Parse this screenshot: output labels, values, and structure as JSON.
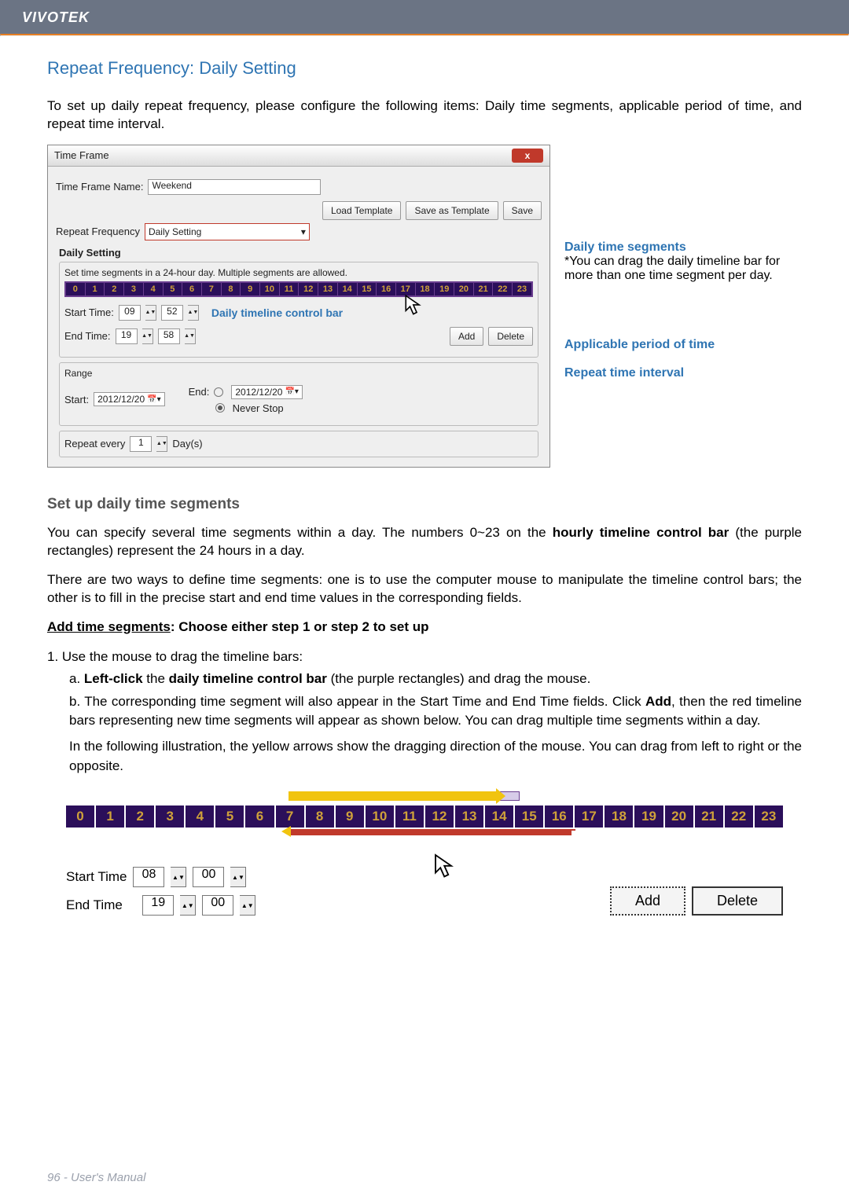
{
  "header": {
    "brand": "VIVOTEK"
  },
  "section_title": "Repeat Frequency: Daily Setting",
  "intro_para": "To set up daily repeat frequency, please configure the following items: Daily time segments, applicable period of time, and repeat time interval.",
  "dialog": {
    "title": "Time Frame",
    "close": "x",
    "name_label": "Time Frame Name:",
    "name_value": "Weekend",
    "repeat_label": "Repeat Frequency",
    "repeat_value": "Daily Setting",
    "buttons": {
      "load": "Load Template",
      "saveas": "Save as Template",
      "save": "Save"
    },
    "daily_heading": "Daily Setting",
    "daily_hint": "Set time segments in a 24-hour day. Multiple segments are allowed.",
    "hours": [
      "0",
      "1",
      "2",
      "3",
      "4",
      "5",
      "6",
      "7",
      "8",
      "9",
      "10",
      "11",
      "12",
      "13",
      "14",
      "15",
      "16",
      "17",
      "18",
      "19",
      "20",
      "21",
      "22",
      "23"
    ],
    "start_label": "Start Time:",
    "start_hh": "09",
    "start_mm": "52",
    "end_label": "End Time:",
    "end_hh": "19",
    "end_mm": "58",
    "inline_caption": "Daily timeline control bar",
    "add_btn": "Add",
    "delete_btn": "Delete",
    "range_heading": "Range",
    "range_start_label": "Start:",
    "range_start_date": "2012/12/20",
    "range_end_label": "End:",
    "range_end_date": "2012/12/20",
    "never_stop": "Never Stop",
    "repeat_every": "Repeat every",
    "repeat_value_n": "1",
    "repeat_unit": "Day(s)"
  },
  "annotations": {
    "a1_title": "Daily time segments",
    "a1_body": "*You can drag the daily timeline bar for more than one time segment per day.",
    "a2_title": "Applicable period of time",
    "a3_title": "Repeat time interval"
  },
  "sub_heading": "Set up daily time segments",
  "para2a": "You can specify several time segments within a day. The numbers 0~23 on the ",
  "para2_bold": "hourly timeline control bar",
  "para2b": " (the purple rectangles) represent the 24 hours in a day.",
  "para3": "There are two ways to define time segments: one is to use the computer mouse to manipulate the timeline control bars; the other is to fill in the precise start and end time values in the corresponding fields.",
  "add_seg_u": "Add time segments",
  "add_seg_rest": ": Choose either step 1 or step 2 to set up",
  "step1": "1. Use the mouse to drag the timeline bars:",
  "step_a_pre": "a. ",
  "step_a_b1": "Left-click",
  "step_a_mid": " the ",
  "step_a_b2": "daily timeline control bar",
  "step_a_post": " (the purple rectangles) and drag the mouse.",
  "step_b_pre": "b. The corresponding time segment will also appear in the Start Time and End Time fields. Click ",
  "step_b_bold": "Add",
  "step_b_post": ", then the red timeline bars representing new time segments will appear as shown below. You can drag multiple time segments within a day.",
  "step_b_extra": "In the following illustration, the yellow arrows show the dragging direction of the mouse. You can drag from left to right or the opposite.",
  "big": {
    "hours": [
      "0",
      "1",
      "2",
      "3",
      "4",
      "5",
      "6",
      "7",
      "8",
      "9",
      "10",
      "11",
      "12",
      "13",
      "14",
      "15",
      "16",
      "17",
      "18",
      "19",
      "20",
      "21",
      "22",
      "23"
    ],
    "start_label": "Start Time",
    "start_hh": "08",
    "start_mm": "00",
    "end_label": "End Time",
    "end_hh": "19",
    "end_mm": "00",
    "add": "Add",
    "delete": "Delete"
  },
  "footer": {
    "page": "96",
    "label": "User's Manual"
  },
  "chart_data": [
    {
      "type": "table",
      "title": "Daily timeline control bar (dialog)",
      "categories": [
        "0",
        "1",
        "2",
        "3",
        "4",
        "5",
        "6",
        "7",
        "8",
        "9",
        "10",
        "11",
        "12",
        "13",
        "14",
        "15",
        "16",
        "17",
        "18",
        "19",
        "20",
        "21",
        "22",
        "23"
      ],
      "start_time": "09:52",
      "end_time": "19:58"
    },
    {
      "type": "table",
      "title": "Daily timeline control bar (illustration)",
      "categories": [
        "0",
        "1",
        "2",
        "3",
        "4",
        "5",
        "6",
        "7",
        "8",
        "9",
        "10",
        "11",
        "12",
        "13",
        "14",
        "15",
        "16",
        "17",
        "18",
        "19",
        "20",
        "21",
        "22",
        "23"
      ],
      "start_time": "08:00",
      "end_time": "19:00",
      "drag_direction_top": "right (8 → 15)",
      "drag_direction_bottom": "left (19 → 8)"
    }
  ]
}
